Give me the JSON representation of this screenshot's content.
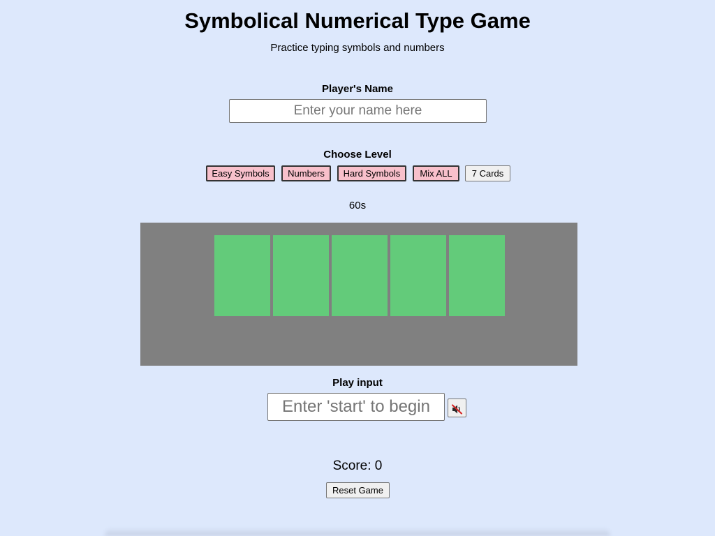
{
  "header": {
    "title": "Symbolical Numerical Type Game",
    "subtitle": "Practice typing symbols and numbers"
  },
  "player": {
    "label": "Player's Name",
    "placeholder": "Enter your name here",
    "value": ""
  },
  "levels": {
    "label": "Choose Level",
    "buttons": [
      {
        "label": "Easy Symbols",
        "highlight_color": "#f8c0cb"
      },
      {
        "label": "Numbers",
        "highlight_color": "#f8c0cb"
      },
      {
        "label": "Hard Symbols",
        "highlight_color": "#f8c0cb"
      },
      {
        "label": "Mix ALL",
        "highlight_color": "#f8c0cb"
      },
      {
        "label": "7 Cards",
        "highlight_color": "#f0f0f0"
      }
    ]
  },
  "timer": {
    "text": "60s"
  },
  "board": {
    "background_color": "#808080",
    "card_color": "#63cb7a",
    "cards": [
      "",
      "",
      "",
      "",
      ""
    ]
  },
  "play": {
    "label": "Play input",
    "placeholder": "Enter 'start' to begin",
    "value": "",
    "mute_icon": "muted-speaker-icon"
  },
  "score": {
    "text": "Score: 0"
  },
  "reset": {
    "label": "Reset Game"
  }
}
